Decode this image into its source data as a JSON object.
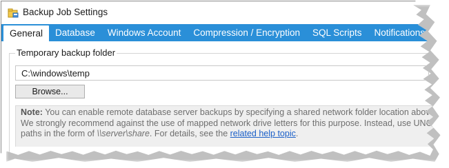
{
  "window": {
    "title": "Backup Job Settings",
    "icon": "backup-job-icon"
  },
  "tabs": [
    {
      "label": "General",
      "active": true
    },
    {
      "label": "Database",
      "active": false
    },
    {
      "label": "Windows Account",
      "active": false
    },
    {
      "label": "Compression / Encryption",
      "active": false
    },
    {
      "label": "SQL Scripts",
      "active": false
    },
    {
      "label": "Notifications",
      "active": false
    }
  ],
  "general": {
    "group_label": "Temporary backup folder",
    "folder_value": "C:\\windows\\temp",
    "browse_label": "Browse...",
    "note": {
      "prefix": "Note:",
      "line1": " You can enable remote database server backups by specifying a shared network folder location above.",
      "line2": "We strongly recommend against the use of mapped network drive letters for this purpose. Instead, use UNC",
      "line3_a": "paths in the form of ",
      "line3_path": "\\\\server\\share",
      "line3_b": ". For details, see the ",
      "link_text": "related help topic",
      "line3_end": "."
    }
  },
  "colors": {
    "tab_bar": "#2a8fd8",
    "link": "#1a5fc8",
    "note_background": "#efefef"
  }
}
